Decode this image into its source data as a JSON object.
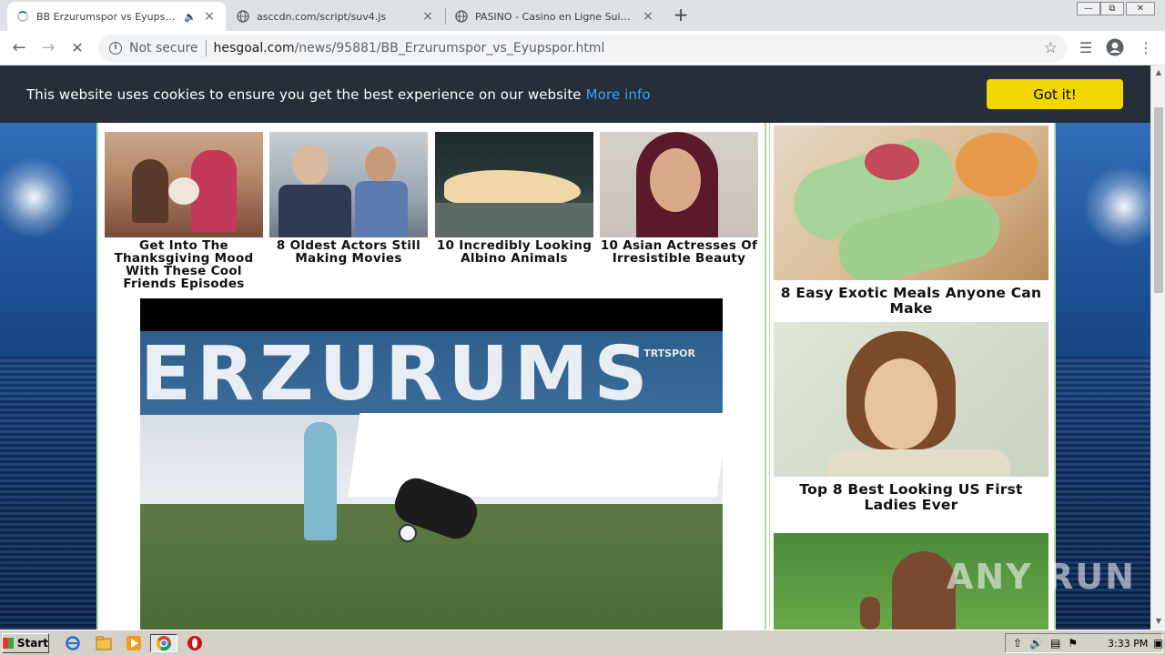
{
  "browser": {
    "tabs": [
      {
        "title": "BB Erzurumspor vs Eyupspor - H",
        "state": "loading"
      },
      {
        "title": "asccdn.com/script/suv4.js",
        "state": "idle"
      },
      {
        "title": "PASINO - Casino en Ligne Suisse - Su",
        "state": "idle"
      }
    ],
    "address": {
      "security_label": "Not secure",
      "host": "hesgoal.com",
      "path": "/news/95881/BB_Erzurumspor_vs_Eyupspor.html"
    },
    "icons": {
      "back": "back-arrow-icon",
      "forward": "forward-arrow-icon",
      "stop": "stop-icon",
      "star": "star-icon",
      "media": "media-control-icon",
      "profile": "profile-icon",
      "menu": "kebab-menu-icon"
    }
  },
  "cookie_banner": {
    "message": "This website uses cookies to ensure you get the best experience on our website",
    "more_link": "More info",
    "accept_label": "Got it!",
    "colors": {
      "background": "#252e39",
      "button": "#f1d600",
      "link": "#31a8f0"
    }
  },
  "articles": [
    {
      "caption": "Get Into The Thanksgiving Mood With These Cool Friends Episodes"
    },
    {
      "caption": "8 Oldest Actors Still Making Movies"
    },
    {
      "caption": "10 Incredibly Looking Albino Animals"
    },
    {
      "caption": "10 Asian Actresses Of Irresistible Beauty"
    }
  ],
  "video": {
    "banner_text": "ERZURUMS",
    "broadcaster_logo": "TRTSPOR"
  },
  "sidebar_ads": [
    {
      "caption": "8 Easy Exotic Meals Anyone Can Make"
    },
    {
      "caption": "Top 8 Best Looking US First Ladies Ever"
    },
    {
      "caption": ""
    }
  ],
  "watermark": "ANY RUN",
  "taskbar": {
    "start_label": "Start",
    "clock": "3:33 PM",
    "apps": [
      "internet-explorer-icon",
      "file-explorer-icon",
      "media-player-icon",
      "chrome-icon",
      "opera-icon"
    ]
  }
}
